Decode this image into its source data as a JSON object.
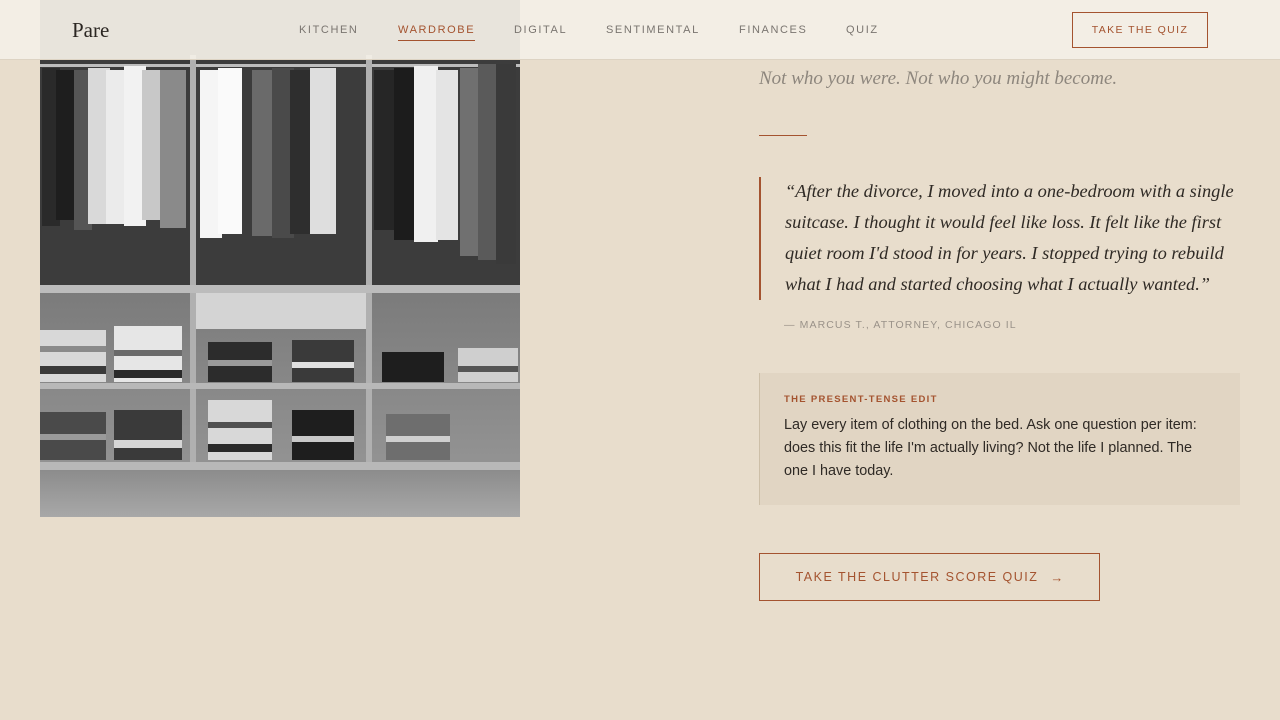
{
  "brand": {
    "logo": "Pare"
  },
  "nav": {
    "items": [
      {
        "label": "KITCHEN",
        "active": false
      },
      {
        "label": "WARDROBE",
        "active": true
      },
      {
        "label": "DIGITAL",
        "active": false
      },
      {
        "label": "SENTIMENTAL",
        "active": false
      },
      {
        "label": "FINANCES",
        "active": false
      },
      {
        "label": "QUIZ",
        "active": false
      }
    ],
    "cta_label": "TAKE THE QUIZ"
  },
  "image": {
    "subject": "black-and-white wardrobe with hanging shirts and folded stacks"
  },
  "content": {
    "lede": "Not who you were. Not who you might become.",
    "quote": "“After the divorce, I moved into a one-bedroom with a single suitcase. I thought it would feel like loss. It felt like the first quiet room I'd stood in for years. I stopped trying to rebuild what I had and started choosing what I actually wanted.”",
    "attribution": "— MARCUS T., ATTORNEY, CHICAGO IL",
    "tip": {
      "label": "THE PRESENT-TENSE EDIT",
      "body": "Lay every item of clothing on the bed. Ask one question per item: does this fit the life I'm actually living? Not the life I planned. The one I have today."
    },
    "cta_label": "TAKE THE CLUTTER SCORE QUIZ",
    "cta_icon": "arrow-right-icon"
  },
  "colors": {
    "accent": "#a4532f",
    "background": "#e8ddcc",
    "nav_bg": "#f3efe7",
    "tip_bg": "#e1d5c3"
  }
}
